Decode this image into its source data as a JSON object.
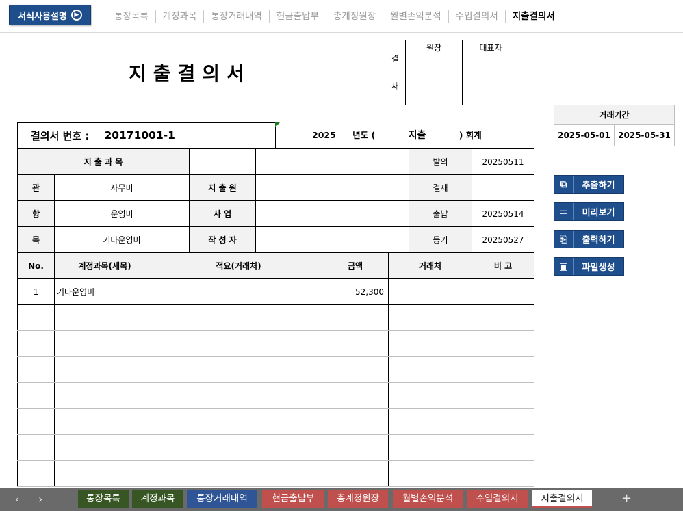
{
  "topnav": {
    "guide_label": "서식사용설명",
    "links": [
      "통장목록",
      "계정과목",
      "통장거래내역",
      "현금출납부",
      "총계정원장",
      "월별손익분석",
      "수입결의서",
      "지출결의서"
    ],
    "active": "지출결의서"
  },
  "doc": {
    "title": "지출결의서",
    "approval": {
      "side_top": "결",
      "side_bottom": "재",
      "col1": "원장",
      "col2": "대표자"
    },
    "resolution_label": "결의서 번호 :",
    "resolution_no": "20171001-1",
    "year": "2025",
    "year_label": "년도 (",
    "type": "지출",
    "type_suffix": ") 회계"
  },
  "period": {
    "label": "거래기간",
    "from": "2025-05-01",
    "to": "2025-05-31"
  },
  "actions": [
    {
      "label": "추출하기",
      "icon": "copy-icon"
    },
    {
      "label": "미리보기",
      "icon": "monitor-icon"
    },
    {
      "label": "출력하기",
      "icon": "print-icon"
    },
    {
      "label": "파일생성",
      "icon": "folder-icon"
    }
  ],
  "account": {
    "header": "지 출 과 목",
    "gwan_label": "관",
    "gwan": "사무비",
    "hang_label": "항",
    "hang": "운영비",
    "mok_label": "목",
    "mok": "기타운영비",
    "payee_label": "지 출 원",
    "business_label": "사 업",
    "writer_label": "작 성 자",
    "dates": [
      {
        "label": "발의",
        "value": "20250511"
      },
      {
        "label": "결재",
        "value": ""
      },
      {
        "label": "출납",
        "value": "20250514"
      },
      {
        "label": "등기",
        "value": "20250527"
      }
    ]
  },
  "items": {
    "headers": [
      "No.",
      "계정과목(세목)",
      "적요(거래처)",
      "금액",
      "거래처",
      "비 고"
    ],
    "rows": [
      {
        "no": "1",
        "account": "기타운영비",
        "memo": "",
        "amount": "52,300",
        "vendor": "",
        "note": ""
      }
    ]
  },
  "sheets": [
    {
      "label": "통장목록",
      "color": "#375623"
    },
    {
      "label": "계정과목",
      "color": "#375623"
    },
    {
      "label": "통장거래내역",
      "color": "#2f5597"
    },
    {
      "label": "현금출납부",
      "color": "#c0504d"
    },
    {
      "label": "총계정원장",
      "color": "#c0504d"
    },
    {
      "label": "월별손익분석",
      "color": "#c0504d"
    },
    {
      "label": "수입결의서",
      "color": "#c0504d"
    },
    {
      "label": "지출결의서",
      "color": "#ffffff"
    }
  ]
}
